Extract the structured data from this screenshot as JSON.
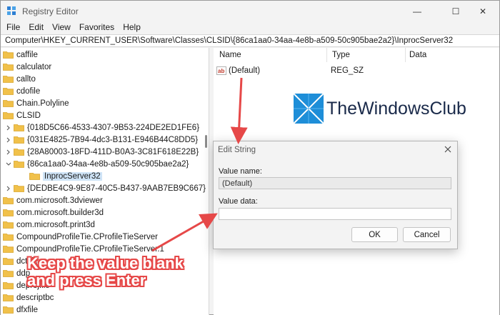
{
  "window": {
    "title": "Registry Editor",
    "minimize_glyph": "—",
    "maximize_glyph": "☐",
    "close_glyph": "✕"
  },
  "menu": [
    "File",
    "Edit",
    "View",
    "Favorites",
    "Help"
  ],
  "address": "Computer\\HKEY_CURRENT_USER\\Software\\Classes\\CLSID\\{86ca1aa0-34aa-4e8b-a509-50c905bae2a2}\\InprocServer32",
  "tree": [
    {
      "label": "caffile"
    },
    {
      "label": "calculator"
    },
    {
      "label": "callto"
    },
    {
      "label": "cdofile"
    },
    {
      "label": "Chain.Polyline"
    },
    {
      "label": "CLSID"
    },
    {
      "label": "{018D5C66-4533-4307-9B53-224DE2ED1FE6}"
    },
    {
      "label": "{031E4825-7B94-4dc3-B131-E946B44C8DD5}"
    },
    {
      "label": "{28A80003-18FD-411D-B0A3-3C81F618E22B}"
    },
    {
      "label": "{86ca1aa0-34aa-4e8b-a509-50c905bae2a2}"
    },
    {
      "label": "InprocServer32"
    },
    {
      "label": "{DEDBE4C9-9E87-40C5-B437-9AAB7EB9C667}"
    },
    {
      "label": "com.microsoft.3dviewer"
    },
    {
      "label": "com.microsoft.builder3d"
    },
    {
      "label": "com.microsoft.print3d"
    },
    {
      "label": "CompoundProfileTie.CProfileTieServer"
    },
    {
      "label": "CompoundProfileTie.CProfileTieServer.1"
    },
    {
      "label": "dctfile"
    },
    {
      "label": "ddp"
    },
    {
      "label": "deprojfile"
    },
    {
      "label": "descriptbc"
    },
    {
      "label": "dfxfile"
    }
  ],
  "values_pane": {
    "columns": [
      "Name",
      "Type",
      "Data"
    ],
    "rows": [
      {
        "name": "(Default)",
        "type": "REG_SZ",
        "data": ""
      }
    ]
  },
  "watermark": "TheWindowsClub",
  "dialog": {
    "title": "Edit String",
    "value_name_label": "Value name:",
    "value_name": "(Default)",
    "value_data_label": "Value data:",
    "value_data": "",
    "ok": "OK",
    "cancel": "Cancel"
  },
  "annotation": {
    "line1": "Keep the value blank",
    "line2": "and press Enter",
    "color": "#e64848"
  },
  "colors": {
    "folder": "#f1c14a",
    "selection": "#cfe4f7",
    "arrow": "#e64848"
  }
}
